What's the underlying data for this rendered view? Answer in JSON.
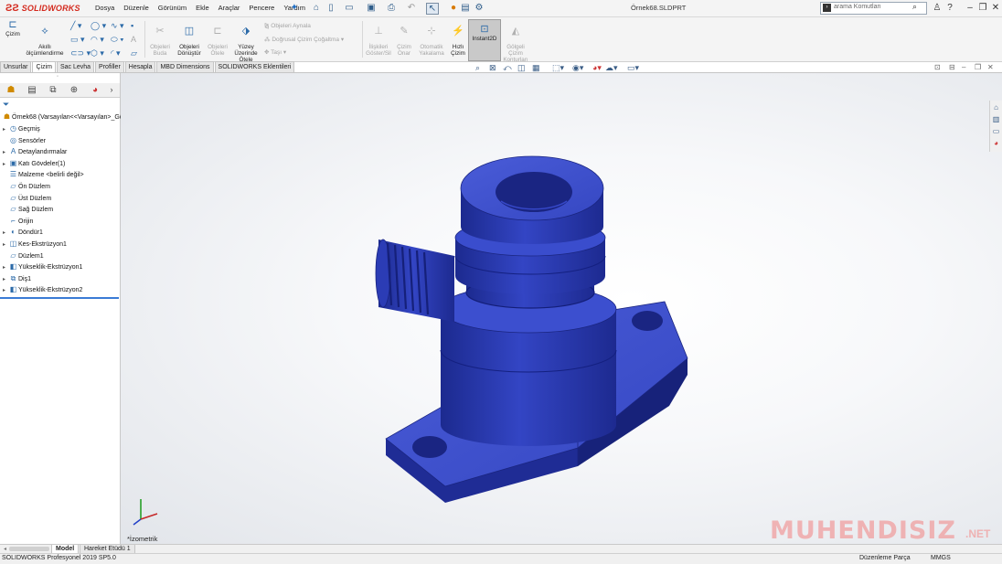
{
  "app": {
    "brand": "SOLIDWORKS",
    "title": "Örnek68.SLDPRT",
    "search_placeholder": "arama Komutları"
  },
  "menu": {
    "items": [
      "Dosya",
      "Düzenle",
      "Görünüm",
      "Ekle",
      "Araçlar",
      "Pencere",
      "Yardım"
    ]
  },
  "commands": {
    "cizim": "Çizim",
    "akilli": "Akıllı\nölçümlendirme",
    "objeleri_buda": "Objeleri\nBuda",
    "objeleri_donustur": "Objeleri\nDönüştür",
    "objeleri_otele": "Objeleri\nÖtele",
    "yuzey_uzerinde": "Yüzey\nÜzerinde\nÖtele",
    "objeleri_aynala": "Objeleri Aynala",
    "dogrusal": "Doğrusal Çizim Çoğaltma",
    "tasi": "Taşı",
    "iliskileri": "İlişkileri\nGöster/Sil",
    "cizim_onar": "Çizim\nOnar",
    "otomatik": "Otomatik\nYakalama",
    "hizli_cizim": "Hızlı\nÇizim",
    "instant2d": "Instant2D",
    "golgeli": "Gölgeli\nÇizim\nKonturları"
  },
  "tabs": [
    "Unsurlar",
    "Çizim",
    "Sac Levha",
    "Profiller",
    "Hesapla",
    "MBD Dimensions",
    "SOLIDWORKS Eklentileri"
  ],
  "active_tab": "Çizim",
  "tree": {
    "root": "Örnek68  (Varsayılan<<Varsayılan>_Gö",
    "items": [
      {
        "label": "Geçmiş",
        "icon": "history-icon",
        "arrow": true
      },
      {
        "label": "Sensörler",
        "icon": "sensor-icon",
        "arrow": false
      },
      {
        "label": "Detaylandırmalar",
        "icon": "annotation-icon",
        "arrow": true
      },
      {
        "label": "Katı Gövdeler(1)",
        "icon": "solid-bodies-icon",
        "arrow": true
      },
      {
        "label": "Malzeme <belirli değil>",
        "icon": "material-icon",
        "arrow": false
      },
      {
        "label": "Ön Düzlem",
        "icon": "plane-icon",
        "arrow": false
      },
      {
        "label": "Üst Düzlem",
        "icon": "plane-icon",
        "arrow": false
      },
      {
        "label": "Sağ Düzlem",
        "icon": "plane-icon",
        "arrow": false
      },
      {
        "label": "Orijin",
        "icon": "origin-icon",
        "arrow": false
      },
      {
        "label": "Döndür1",
        "icon": "revolve-icon",
        "arrow": true
      },
      {
        "label": "Kes-Ekstrüzyon1",
        "icon": "cut-extrude-icon",
        "arrow": true
      },
      {
        "label": "Düzlem1",
        "icon": "plane-icon",
        "arrow": false
      },
      {
        "label": "Yükseklik-Ekstrüzyon1",
        "icon": "boss-extrude-icon",
        "arrow": true
      },
      {
        "label": "Diş1",
        "icon": "thread-icon",
        "arrow": true
      },
      {
        "label": "Yükseklik-Ekstrüzyon2",
        "icon": "boss-extrude-icon",
        "arrow": true
      }
    ]
  },
  "bottom_tabs": [
    "Model",
    "Hareket Etüdü 1"
  ],
  "view_label": "*İzometrik",
  "status": {
    "left": "SOLIDWORKS Profesyonel 2019 SP5.0",
    "mode": "Düzenleme Parça",
    "units": "MMGS"
  },
  "watermark": {
    "text": "MUHENDISIZ",
    "suffix": ".NET"
  },
  "colors": {
    "model": "#2c3fb5",
    "brand": "#d42a1e",
    "accent": "#2b6aa8"
  }
}
